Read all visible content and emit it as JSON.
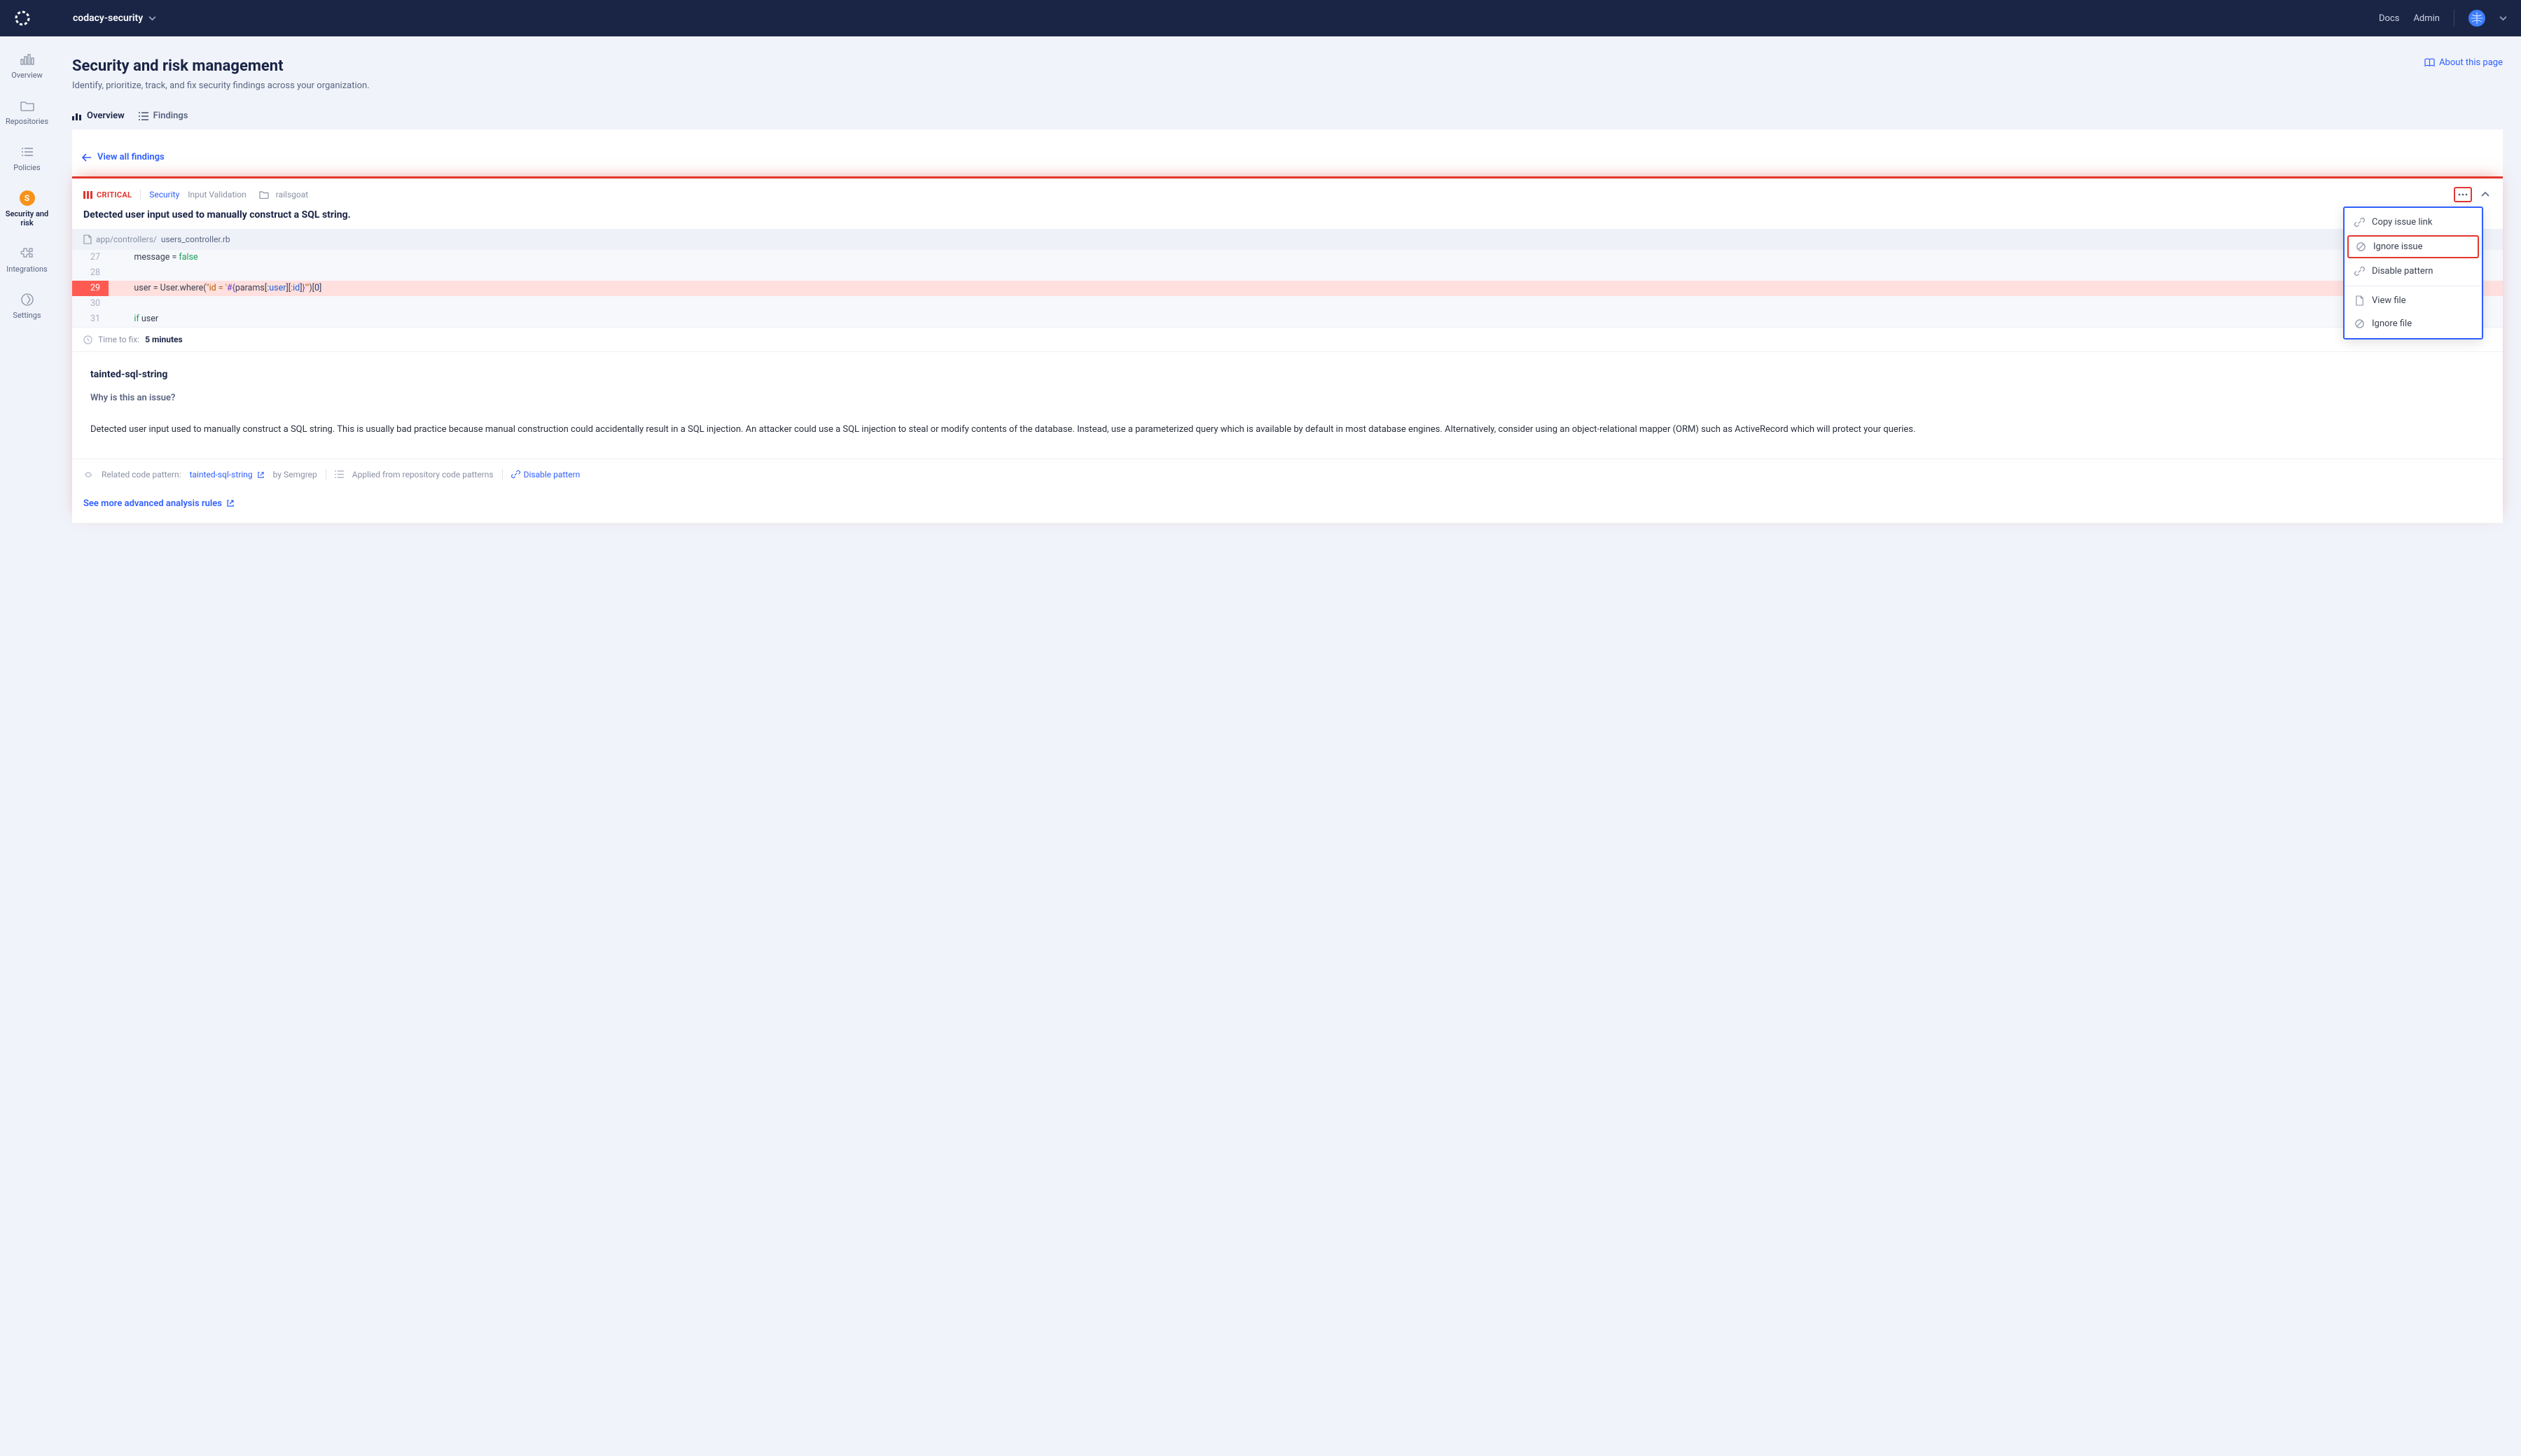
{
  "topbar": {
    "org_name": "codacy-security",
    "links": {
      "docs": "Docs",
      "admin": "Admin"
    }
  },
  "sidebar": {
    "items": [
      {
        "label": "Overview"
      },
      {
        "label": "Repositories"
      },
      {
        "label": "Policies"
      },
      {
        "label": "Security and risk"
      },
      {
        "label": "Integrations"
      },
      {
        "label": "Settings"
      }
    ]
  },
  "page": {
    "title": "Security and risk management",
    "subtitle": "Identify, prioritize, track, and fix security findings across your organization.",
    "about_link": "About this page"
  },
  "tabs": {
    "overview": "Overview",
    "findings": "Findings"
  },
  "view_all": "View all findings",
  "issue": {
    "severity": "CRITICAL",
    "category": "Security",
    "subcategory": "Input Validation",
    "repo": "railsgoat",
    "title": "Detected user input used to manually construct a SQL string.",
    "file_path_dir": "app/controllers/",
    "file_path_file": "users_controller.rb",
    "time_fix_label": "Time to fix:",
    "time_fix_value": "5 minutes"
  },
  "code": {
    "lines": [
      {
        "n": "27"
      },
      {
        "n": "28"
      },
      {
        "n": "29"
      },
      {
        "n": "30"
      },
      {
        "n": "31"
      }
    ]
  },
  "dropdown": {
    "copy_link": "Copy issue link",
    "ignore_issue": "Ignore issue",
    "disable_pattern": "Disable pattern",
    "view_file": "View file",
    "ignore_file": "Ignore file"
  },
  "description": {
    "heading": "tainted-sql-string",
    "why": "Why is this an issue?",
    "body": "Detected user input used to manually construct a SQL string. This is usually bad practice because manual construction could accidentally result in a SQL injection. An attacker could use a SQL injection to steal or modify contents of the database. Instead, use a parameterized query which is available by default in most database engines. Alternatively, consider using an object-relational mapper (ORM) such as ActiveRecord which will protect your queries."
  },
  "footer": {
    "related_label": "Related code pattern:",
    "pattern_name": "tainted-sql-string",
    "by_label": "by Semgrep",
    "applied_from": "Applied from repository code patterns",
    "disable_pattern": "Disable pattern",
    "advanced": "See more advanced analysis rules"
  }
}
